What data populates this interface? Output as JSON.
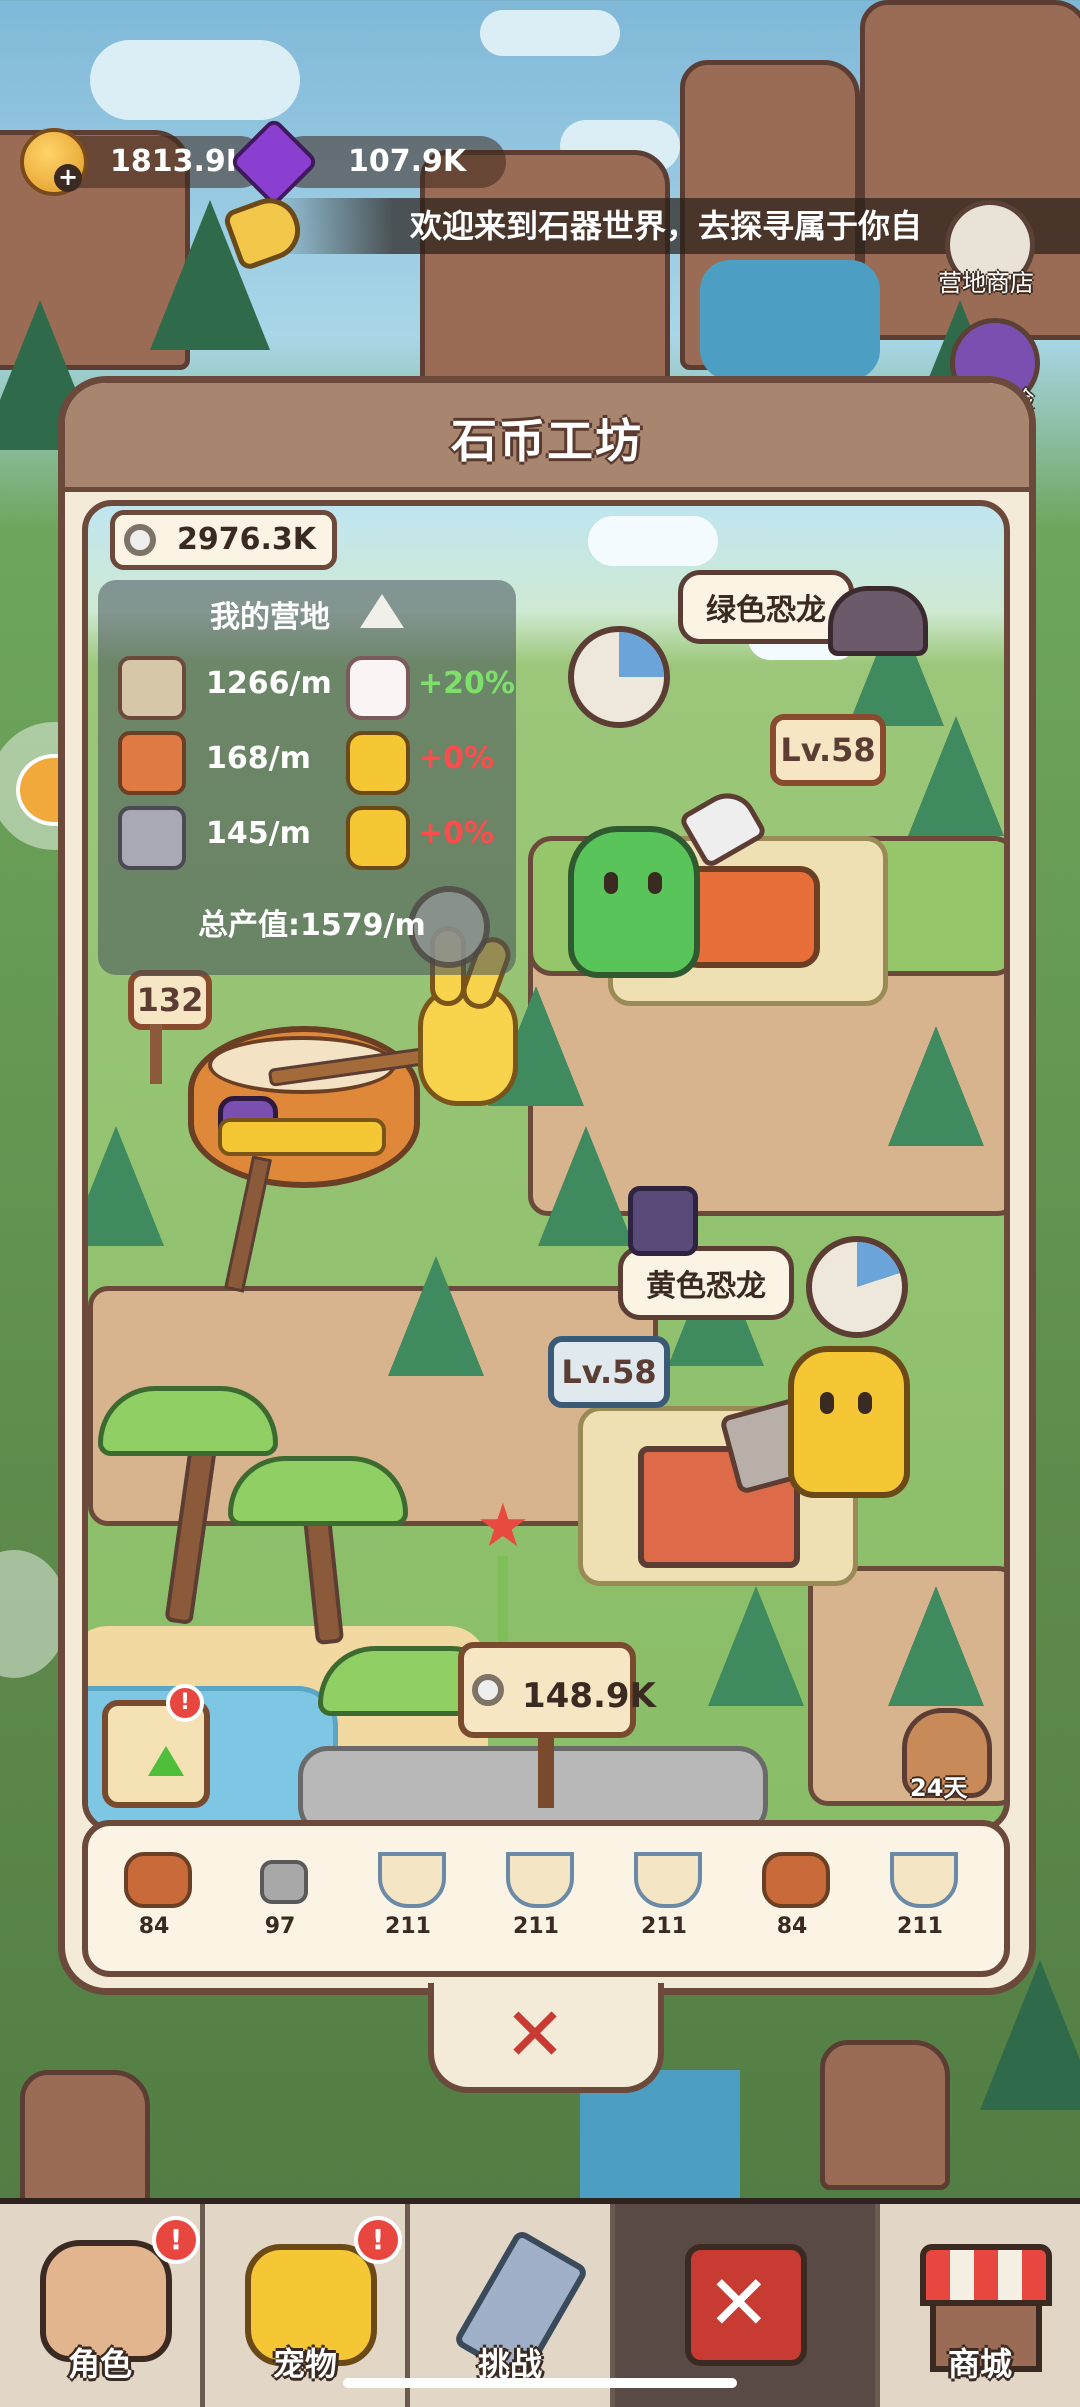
{
  "top_bar": {
    "gold": "1813.9K",
    "gems": "107.9K",
    "ticker_text": "欢迎来到石器世界，去探寻属于你自"
  },
  "side_buttons": {
    "camp_shop": "营地商店",
    "adventure_partial": "险"
  },
  "panel": {
    "title": "石币工坊",
    "balance": "2976.3K",
    "stats": {
      "title": "我的营地",
      "rows": [
        {
          "rate": "1266/m",
          "bonus": "+20%",
          "bonus_color": "#7ee06b"
        },
        {
          "rate": "168/m",
          "bonus": "+0%",
          "bonus_color": "#ff4b4b"
        },
        {
          "rate": "145/m",
          "bonus": "+0%",
          "bonus_color": "#ff4b4b"
        }
      ],
      "total": "总产值:1579/m"
    },
    "behind_label": "黄色兔子",
    "level_sign_pot": "132",
    "green_dino": {
      "name": "绿色恐龙",
      "level": "Lv.58"
    },
    "yellow_dino": {
      "name": "黄色恐龙",
      "level": "Lv.58"
    },
    "upgrade_cost": "148.9K",
    "boar_days": "24天"
  },
  "resources": [
    {
      "icon": "wood-logs-icon",
      "cost": "84"
    },
    {
      "icon": "stone-icon",
      "cost": "97"
    },
    {
      "icon": "soup-bowl-icon",
      "cost": "211"
    },
    {
      "icon": "soup-bowl-icon",
      "cost": "211"
    },
    {
      "icon": "soup-bowl-icon",
      "cost": "211"
    },
    {
      "icon": "wood-logs-icon",
      "cost": "84"
    },
    {
      "icon": "soup-bowl-icon",
      "cost": "211"
    }
  ],
  "bottom_nav": {
    "items": [
      {
        "label": "角色",
        "badge": "!"
      },
      {
        "label": "宠物",
        "badge": "!"
      },
      {
        "label": "挑战",
        "badge": ""
      },
      {
        "label": "",
        "badge": ""
      },
      {
        "label": "商城",
        "badge": ""
      }
    ]
  },
  "colors": {
    "panel_border": "#6b4a3c",
    "close_red": "#c73b32",
    "bonus_green": "#7ee06b",
    "bonus_red": "#ff4b4b"
  }
}
